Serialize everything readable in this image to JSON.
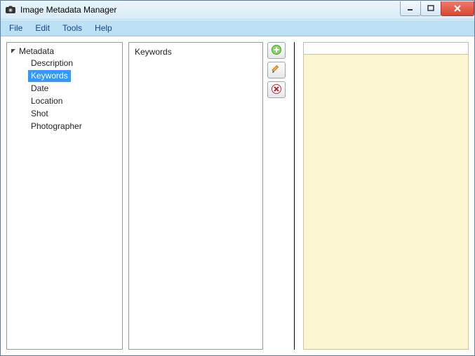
{
  "window": {
    "title": "Image Metadata Manager"
  },
  "menu": {
    "file": "File",
    "edit": "Edit",
    "tools": "Tools",
    "help": "Help"
  },
  "tree": {
    "root": "Metadata",
    "items": [
      "Description",
      "Keywords",
      "Date",
      "Location",
      "Shot",
      "Photographer"
    ],
    "selected_index": 1
  },
  "list": {
    "header": "Keywords"
  },
  "icons": {
    "add": "add-icon",
    "edit": "edit-icon",
    "delete": "delete-icon"
  }
}
